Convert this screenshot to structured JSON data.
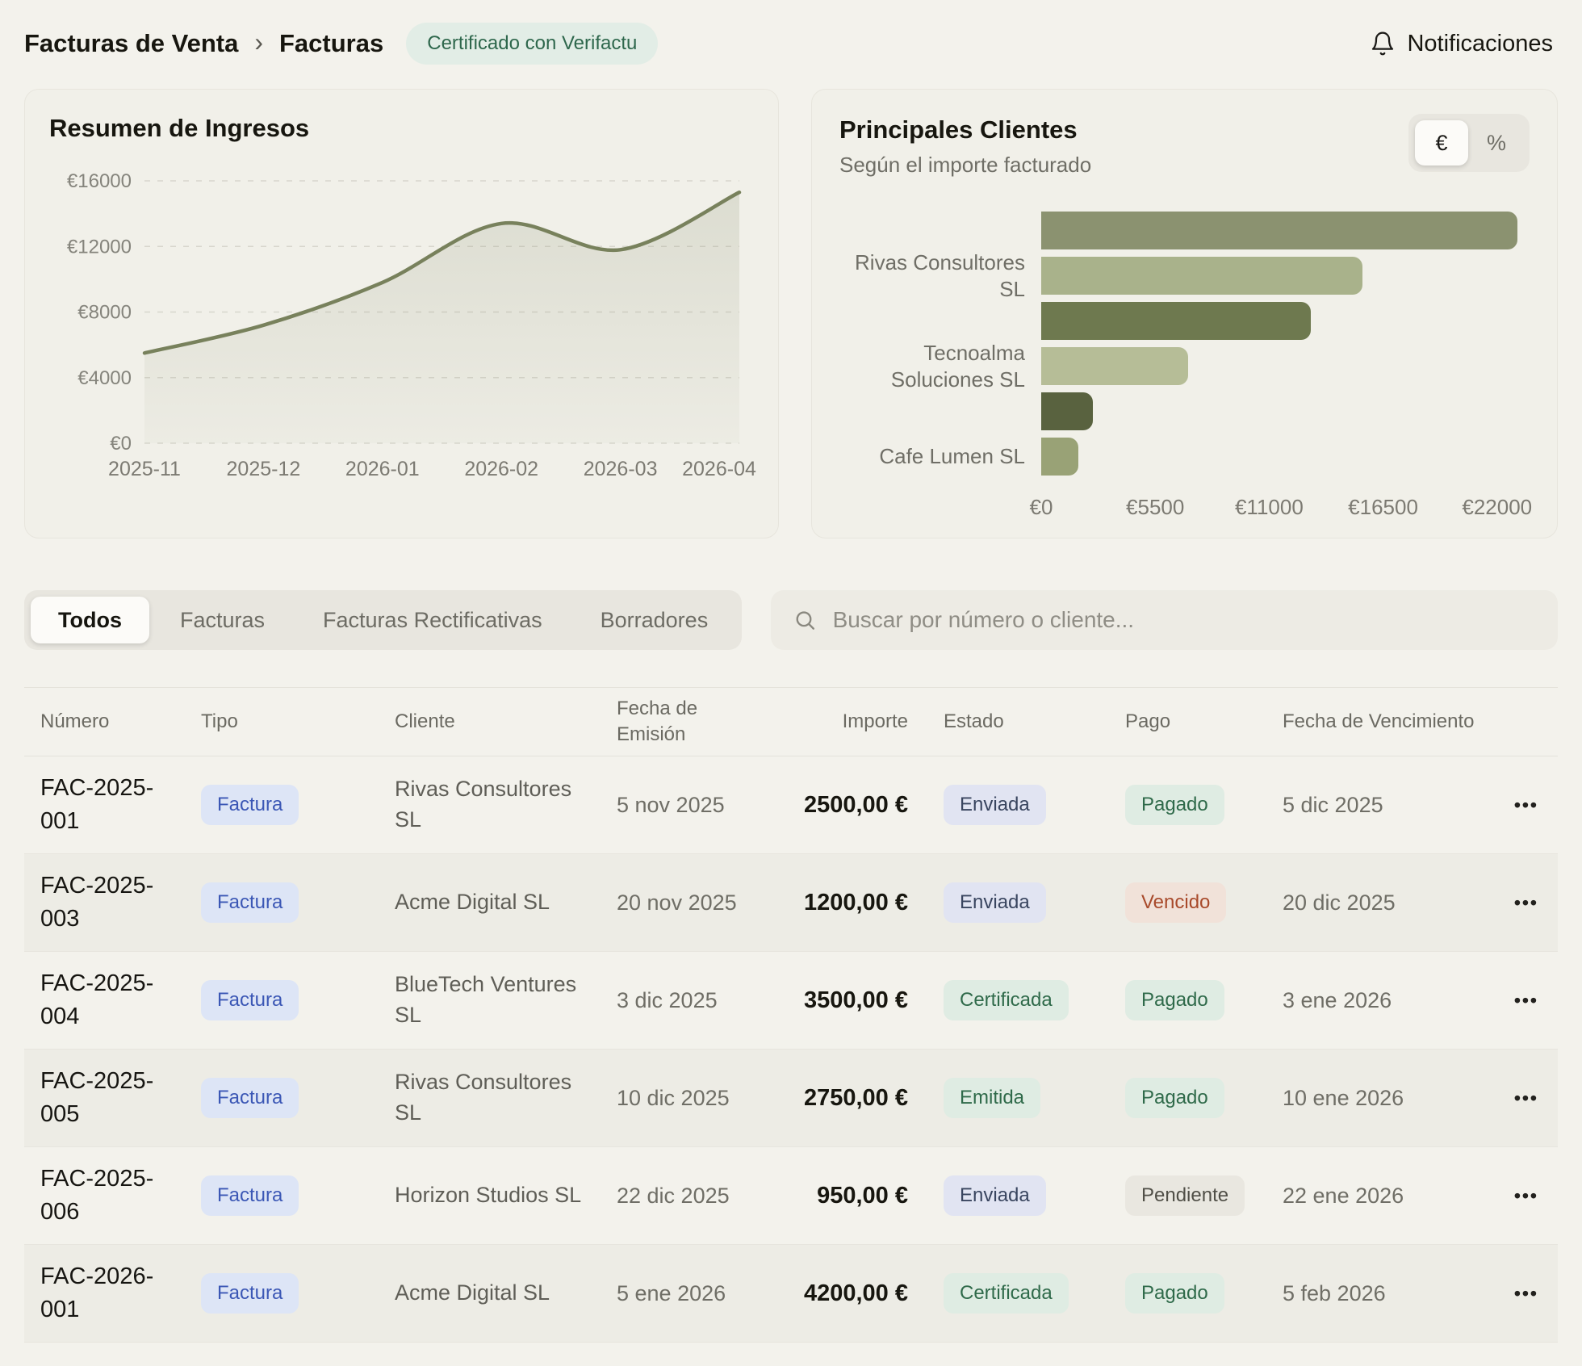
{
  "header": {
    "breadcrumb_parent": "Facturas de Venta",
    "breadcrumb_separator": "›",
    "breadcrumb_current": "Facturas",
    "badge": "Certificado con Verifactu",
    "notifications_label": "Notificaciones"
  },
  "chart_data": [
    {
      "type": "line",
      "title": "Resumen de Ingresos",
      "x": [
        "2025-11",
        "2025-12",
        "2026-01",
        "2026-02",
        "2026-03",
        "2026-04"
      ],
      "values": [
        5500,
        7200,
        9800,
        13400,
        11800,
        15300
      ],
      "ylim": [
        0,
        16000
      ],
      "yticks": [
        "€0",
        "€4000",
        "€8000",
        "€12000",
        "€16000"
      ],
      "ytick_values": [
        0,
        4000,
        8000,
        12000,
        16000
      ],
      "grid": "dashed horizontal",
      "line_color": "#78815c",
      "area_fill": "rgba(124,132,97,0.14)"
    },
    {
      "type": "bar",
      "orientation": "horizontal",
      "title": "Principales Clientes",
      "subtitle": "Según el importe facturado",
      "bars": [
        {
          "label": "",
          "value": 23000,
          "color": "#8b9270"
        },
        {
          "label": "Rivas Consultores SL",
          "value": 15500,
          "color": "#a9b28b"
        },
        {
          "label": "",
          "value": 13000,
          "color": "#6e794f"
        },
        {
          "label": "Tecnoalma Soluciones SL",
          "value": 7100,
          "color": "#b6bd97"
        },
        {
          "label": "",
          "value": 2500,
          "color": "#59623f"
        },
        {
          "label": "Cafe Lumen SL",
          "value": 1800,
          "color": "#99a276"
        }
      ],
      "xlim": [
        0,
        23100
      ],
      "xticks": [
        "€0",
        "€5500",
        "€11000",
        "€16500",
        "€22000"
      ],
      "xtick_values": [
        0,
        5500,
        11000,
        16500,
        22000
      ],
      "unit_toggle": {
        "options": [
          "€",
          "%"
        ],
        "selected": "€"
      }
    }
  ],
  "tabs": [
    {
      "label": "Todos",
      "active": true
    },
    {
      "label": "Facturas",
      "active": false
    },
    {
      "label": "Facturas Rectificativas",
      "active": false
    },
    {
      "label": "Borradores",
      "active": false
    }
  ],
  "search": {
    "placeholder": "Buscar por número o cliente..."
  },
  "table": {
    "columns": [
      "Número",
      "Tipo",
      "Cliente",
      "Fecha de Emisión",
      "Importe",
      "Estado",
      "Pago",
      "Fecha de Vencimiento"
    ],
    "actions_icon": "•••",
    "rows": [
      {
        "numero": "FAC-2025-001",
        "tipo": "Factura",
        "cliente": "Rivas Consultores SL",
        "emision": "5 nov 2025",
        "importe": "2500,00 €",
        "estado": "Enviada",
        "estado_color": "blue",
        "pago": "Pagado",
        "pago_color": "green",
        "vencimiento": "5 dic 2025"
      },
      {
        "numero": "FAC-2025-003",
        "tipo": "Factura",
        "cliente": "Acme Digital SL",
        "emision": "20 nov 2025",
        "importe": "1200,00 €",
        "estado": "Enviada",
        "estado_color": "blue",
        "pago": "Vencido",
        "pago_color": "red",
        "vencimiento": "20 dic 2025"
      },
      {
        "numero": "FAC-2025-004",
        "tipo": "Factura",
        "cliente": "BlueTech Ventures SL",
        "emision": "3 dic 2025",
        "importe": "3500,00 €",
        "estado": "Certificada",
        "estado_color": "green",
        "pago": "Pagado",
        "pago_color": "green",
        "vencimiento": "3 ene 2026"
      },
      {
        "numero": "FAC-2025-005",
        "tipo": "Factura",
        "cliente": "Rivas Consultores SL",
        "emision": "10 dic 2025",
        "importe": "2750,00 €",
        "estado": "Emitida",
        "estado_color": "green",
        "pago": "Pagado",
        "pago_color": "green",
        "vencimiento": "10 ene 2026"
      },
      {
        "numero": "FAC-2025-006",
        "tipo": "Factura",
        "cliente": "Horizon Studios SL",
        "emision": "22 dic 2025",
        "importe": "950,00 €",
        "estado": "Enviada",
        "estado_color": "blue",
        "pago": "Pendiente",
        "pago_color": "gray",
        "vencimiento": "22 ene 2026"
      },
      {
        "numero": "FAC-2026-001",
        "tipo": "Factura",
        "cliente": "Acme Digital SL",
        "emision": "5 ene 2026",
        "importe": "4200,00 €",
        "estado": "Certificada",
        "estado_color": "green",
        "pago": "Pagado",
        "pago_color": "green",
        "vencimiento": "5 feb 2026"
      }
    ]
  }
}
